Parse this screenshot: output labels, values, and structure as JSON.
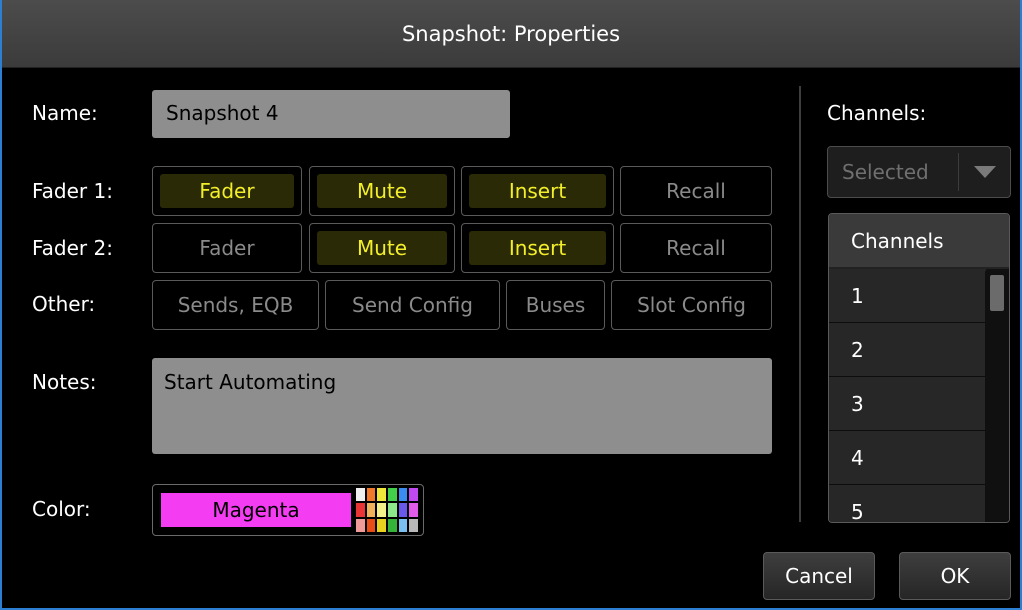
{
  "window": {
    "title": "Snapshot: Properties"
  },
  "labels": {
    "name": "Name:",
    "fader1": "Fader 1:",
    "fader2": "Fader 2:",
    "other": "Other:",
    "notes": "Notes:",
    "color": "Color:",
    "channels": "Channels:"
  },
  "name_value": "Snapshot 4",
  "fader1": [
    {
      "label": "Fader",
      "active": true
    },
    {
      "label": "Mute",
      "active": true
    },
    {
      "label": "Insert",
      "active": true
    },
    {
      "label": "Recall",
      "active": false
    }
  ],
  "fader2": [
    {
      "label": "Fader",
      "active": false
    },
    {
      "label": "Mute",
      "active": true
    },
    {
      "label": "Insert",
      "active": true
    },
    {
      "label": "Recall",
      "active": false
    }
  ],
  "other": [
    {
      "label": "Sends, EQB",
      "active": false
    },
    {
      "label": "Send Config",
      "active": false
    },
    {
      "label": "Buses",
      "active": false
    },
    {
      "label": "Slot Config",
      "active": false
    }
  ],
  "notes_value": "Start Automating",
  "color": {
    "name": "Magenta",
    "hex": "#f43cf2"
  },
  "channels": {
    "filter_selected": "Selected",
    "header": "Channels",
    "rows": [
      "1",
      "2",
      "3",
      "4",
      "5"
    ]
  },
  "footer": {
    "cancel": "Cancel",
    "ok": "OK"
  },
  "colors": {
    "active_text": "#f2ef2a",
    "active_bg": "#2b2a07",
    "window_border": "#2d7fd4"
  }
}
